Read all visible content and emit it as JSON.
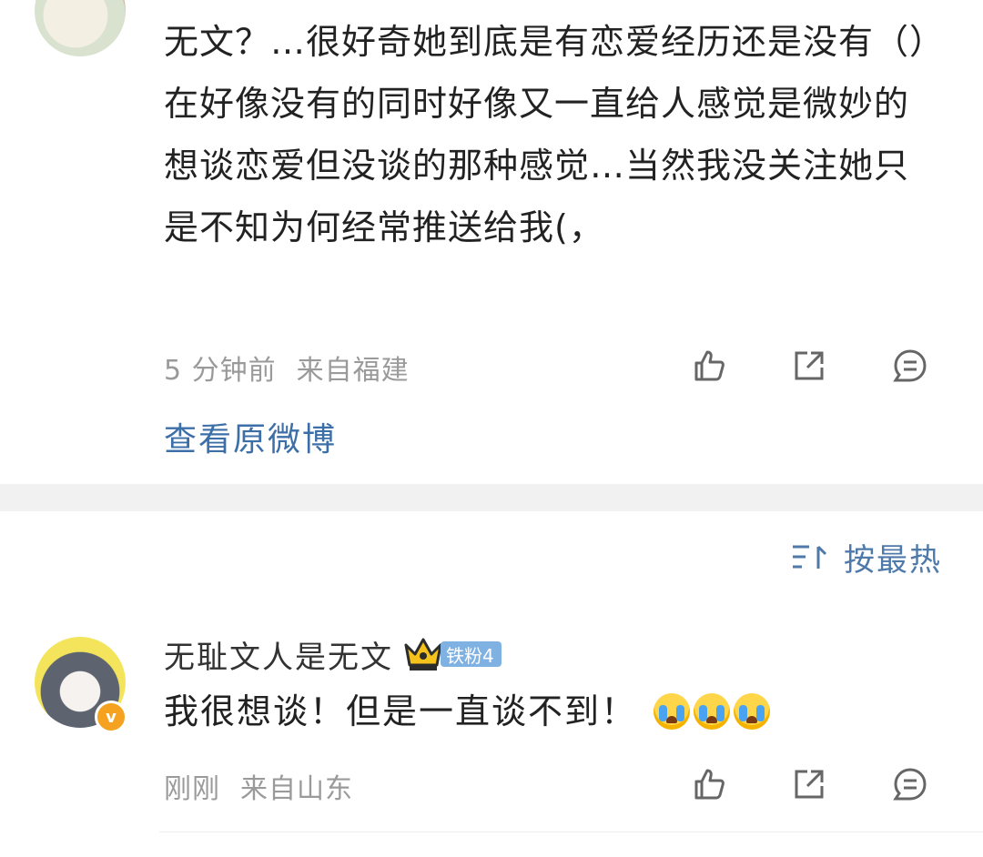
{
  "post": {
    "text": "无文？…很好奇她到底是有恋爱经历还是没有（）在好像没有的同时好像又一直给人感觉是微妙的想谈恋爱但没谈的那种感觉…当然我没关注她只是不知为何经常推送给我(，",
    "time": "5 分钟前",
    "location": "来自福建",
    "view_original": "查看原微博",
    "icons": [
      "like-icon",
      "share-icon",
      "comment-icon"
    ]
  },
  "sort": {
    "label": "按最热",
    "icon": "sort-icon"
  },
  "comment": {
    "username": "无耻文人是无文",
    "badge": "铁粉4",
    "verified_mark": "v",
    "text": "我很想谈！但是一直谈不到！",
    "emojis": [
      "crying-emoji",
      "crying-emoji",
      "crying-emoji"
    ],
    "time": "刚刚",
    "location": "来自山东",
    "icons": [
      "like-icon",
      "share-icon",
      "comment-icon"
    ]
  },
  "colors": {
    "text": "#222222",
    "meta": "#9a9a9a",
    "link": "#3c6fa8",
    "sort": "#4f79a8",
    "badge": "#7fb1e3",
    "divider": "#f1f1f1"
  }
}
